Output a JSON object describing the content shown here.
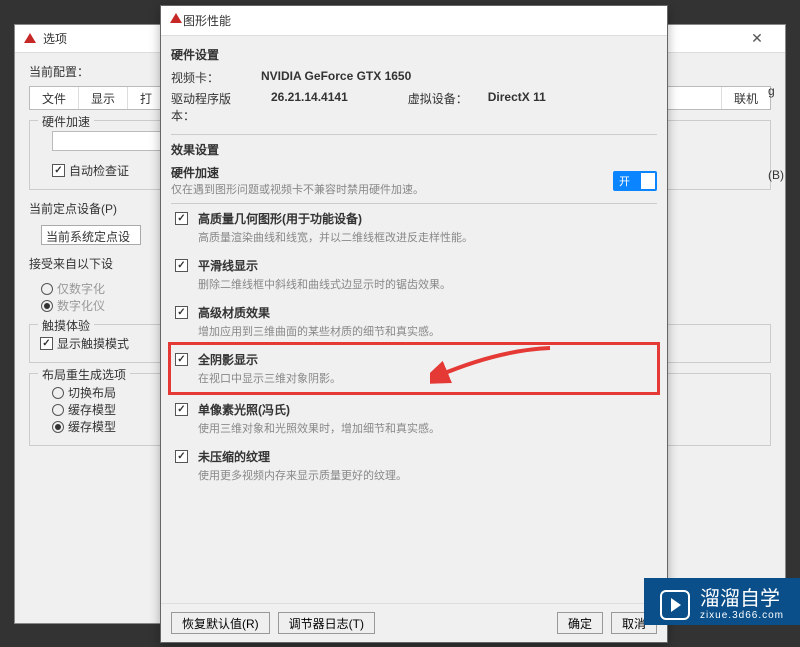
{
  "backDialog": {
    "title": "选项",
    "currentConfig": "当前配置：",
    "tabs": {
      "file": "文件",
      "display": "显示",
      "next": "打",
      "network": "联机"
    },
    "hwAccelGroup": "硬件加速",
    "autoCheck": "自动检查证",
    "pointerGroup": "当前定点设备(P)",
    "pointerCombo": "当前系统定点设",
    "acceptGroup": "接受来自以下设",
    "radio1": "仅数字化",
    "radio2": "数字化仪",
    "touchGroup": "触摸体验",
    "touchCheck": "显示触摸模式",
    "layoutGroup": "布局重生成选项",
    "layoutRadio1": "切换布局",
    "layoutRadio2": "缓存模型",
    "layoutRadio3": "缓存模型",
    "rightPartial1": "g",
    "rightPartial2": "(B)"
  },
  "frontDialog": {
    "title": "图形性能",
    "hwSection": "硬件设置",
    "videoCard": "视频卡：",
    "videoCardVal": "NVIDIA GeForce GTX 1650",
    "driverVer": "驱动程序版本：",
    "driverVerVal": "26.21.14.4141",
    "virtualDev": "虚拟设备：",
    "virtualDevVal": "DirectX 11",
    "fxSection": "效果设置",
    "hwAccel": "硬件加速",
    "hwAccelToggle": "开",
    "hwAccelHint": "仅在遇到图形问题或视频卡不兼容时禁用硬件加速。",
    "items": [
      {
        "title": "高质量几何图形(用于功能设备)",
        "desc": "高质量渲染曲线和线宽，并以二维线框改进反走样性能。"
      },
      {
        "title": "平滑线显示",
        "desc": "删除二维线框中斜线和曲线式边显示时的锯齿效果。"
      },
      {
        "title": "高级材质效果",
        "desc": "增加应用到三维曲面的某些材质的细节和真实感。"
      },
      {
        "title": "全阴影显示",
        "desc": "在视口中显示三维对象阴影。"
      },
      {
        "title": "单像素光照(冯氏)",
        "desc": "使用三维对象和光照效果时，增加细节和真实感。"
      },
      {
        "title": "未压缩的纹理",
        "desc": "使用更多视频内存来显示质量更好的纹理。"
      }
    ],
    "buttons": {
      "reset": "恢复默认值(R)",
      "log": "调节器日志(T)",
      "ok": "确定",
      "cancel": "取消"
    }
  },
  "watermark": {
    "brand": "溜溜自学",
    "url": "zixue.3d66.com"
  }
}
